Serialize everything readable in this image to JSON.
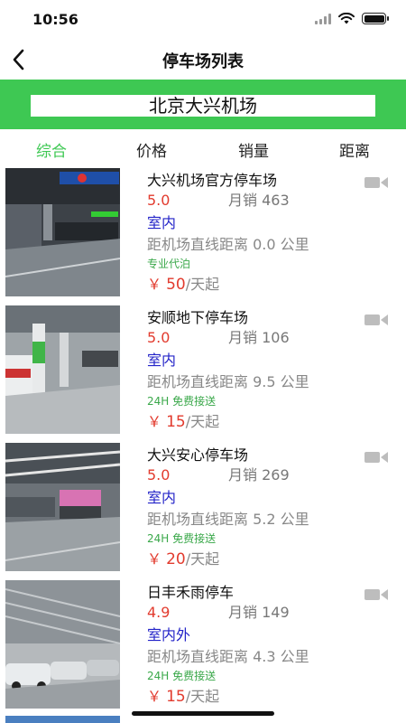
{
  "status_bar": {
    "time": "10:56"
  },
  "nav": {
    "title": "停车场列表",
    "back_icon": "chevron-left-icon"
  },
  "search": {
    "value": "北京大兴机场"
  },
  "sort_tabs": [
    {
      "label": "综合",
      "active": true
    },
    {
      "label": "价格",
      "active": false
    },
    {
      "label": "销量",
      "active": false
    },
    {
      "label": "距离",
      "active": false
    }
  ],
  "colors": {
    "accent_green": "#3ec853",
    "price_red": "#e23b2e",
    "type_blue": "#2323c8",
    "tag_green": "#3aa84a"
  },
  "lots": [
    {
      "name": "大兴机场官方停车场",
      "rating": "5.0",
      "sales": "月销 463",
      "type": "室内",
      "distance": "距机场直线距离 0.0 公里",
      "tag": "专业代泊",
      "price_currency": "￥",
      "price": "50",
      "price_unit": "/天起",
      "icon": "video-camera-icon"
    },
    {
      "name": "安顺地下停车场",
      "rating": "5.0",
      "sales": "月销 106",
      "type": "室内",
      "distance": "距机场直线距离 9.5 公里",
      "tag": "24H 免费接送",
      "price_currency": "￥",
      "price": "15",
      "price_unit": "/天起",
      "icon": "video-camera-icon"
    },
    {
      "name": "大兴安心停车场",
      "rating": "5.0",
      "sales": "月销 269",
      "type": "室内",
      "distance": "距机场直线距离 5.2 公里",
      "tag": "24H 免费接送",
      "price_currency": "￥",
      "price": "20",
      "price_unit": "/天起",
      "icon": "video-camera-icon"
    },
    {
      "name": "日丰禾雨停车",
      "rating": "4.9",
      "sales": "月销 149",
      "type": "室内外",
      "distance": "距机场直线距离 4.3 公里",
      "tag": "24H 免费接送",
      "price_currency": "￥",
      "price": "15",
      "price_unit": "/天起",
      "icon": "video-camera-icon"
    }
  ]
}
